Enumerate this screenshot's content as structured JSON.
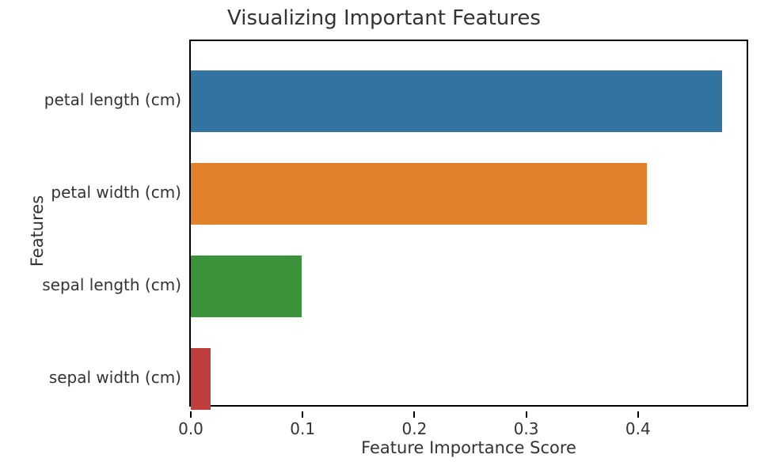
{
  "chart_data": {
    "type": "bar",
    "orientation": "horizontal",
    "title": "Visualizing Important Features",
    "xlabel": "Feature Importance Score",
    "ylabel": "Features",
    "xlim": [
      0.0,
      0.5
    ],
    "xticks": [
      0.0,
      0.1,
      0.2,
      0.3,
      0.4
    ],
    "xtick_labels": [
      "0.0",
      "0.1",
      "0.2",
      "0.3",
      "0.4"
    ],
    "series": [
      {
        "name": "petal length (cm)",
        "value": 0.475,
        "color": "#3274a1"
      },
      {
        "name": "petal width (cm)",
        "value": 0.408,
        "color": "#e1812c"
      },
      {
        "name": "sepal length (cm)",
        "value": 0.099,
        "color": "#3a923a"
      },
      {
        "name": "sepal width (cm)",
        "value": 0.018,
        "color": "#c03d3e"
      }
    ]
  }
}
